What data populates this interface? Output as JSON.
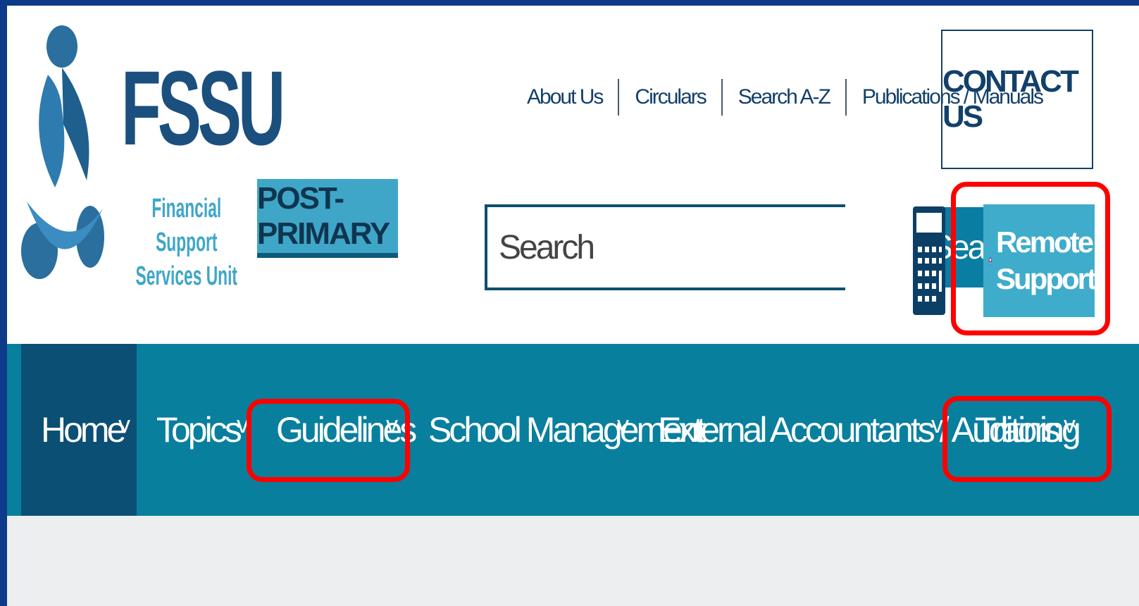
{
  "brand": {
    "title": "FSSU",
    "subtitle_line1": "Financial Support",
    "subtitle_line2": "Services Unit",
    "sector_badge": "POST-PRIMARY"
  },
  "top_links": [
    "About Us",
    "Circulars",
    "Search A-Z",
    "Publications / Manuals"
  ],
  "contact_label": "CONTACT US",
  "search": {
    "placeholder": "Search",
    "button_label": "Search"
  },
  "remote_support": {
    "line1": "Remote",
    "line2": "Support"
  },
  "nav": {
    "items": [
      "Home",
      "Topics",
      "Guidelines",
      "School Management",
      "External Accountants / Auditors",
      "Training"
    ]
  },
  "colors": {
    "page_border": "#0d3b8a",
    "nav_bg": "#097f9e",
    "nav_active_bg": "#0c4f74",
    "accent_light": "#3fa6c8",
    "highlight": "#ff0000"
  }
}
